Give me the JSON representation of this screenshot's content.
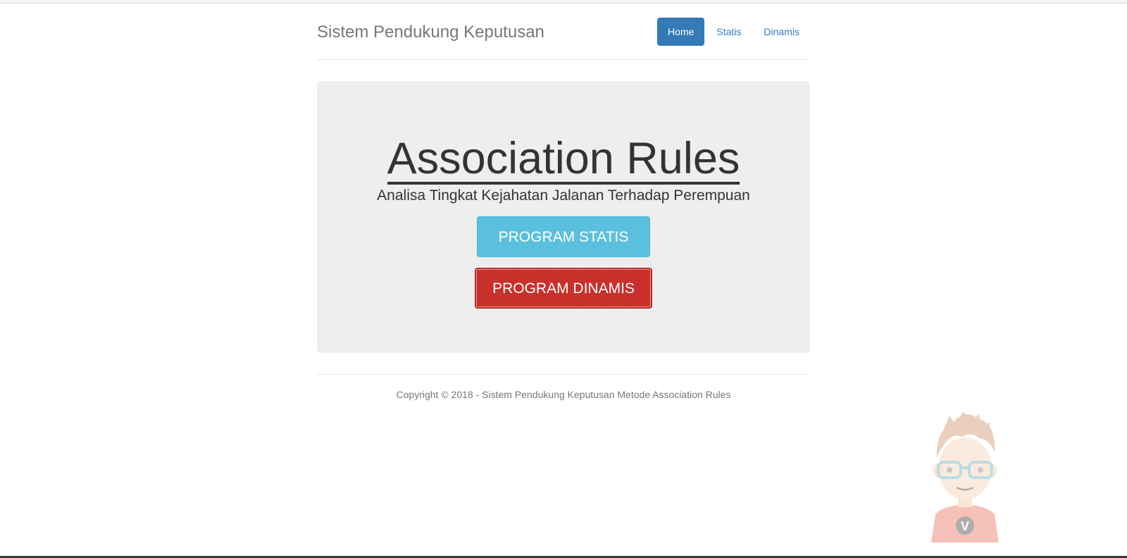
{
  "header": {
    "brand": "Sistem Pendukung Keputusan",
    "nav": [
      {
        "label": "Home",
        "active": true
      },
      {
        "label": "Statis",
        "active": false
      },
      {
        "label": "Dinamis",
        "active": false
      }
    ]
  },
  "jumbotron": {
    "title": "Association Rules",
    "subtitle": "Analisa Tingkat Kejahatan Jalanan Terhadap Perempuan",
    "button_statis": "PROGRAM STATIS",
    "button_dinamis": "PROGRAM DINAMIS"
  },
  "footer": {
    "copyright": "Copyright © 2018 - Sistem Pendukung Keputusan Metode Association Rules"
  },
  "mascot": {
    "badge_letter": "V",
    "icon": "cartoon-boy-with-glasses"
  },
  "colors": {
    "primary": "#337ab7",
    "info": "#5bc0de",
    "danger": "#c9302c",
    "jumbotron_bg": "#eeeeee"
  }
}
